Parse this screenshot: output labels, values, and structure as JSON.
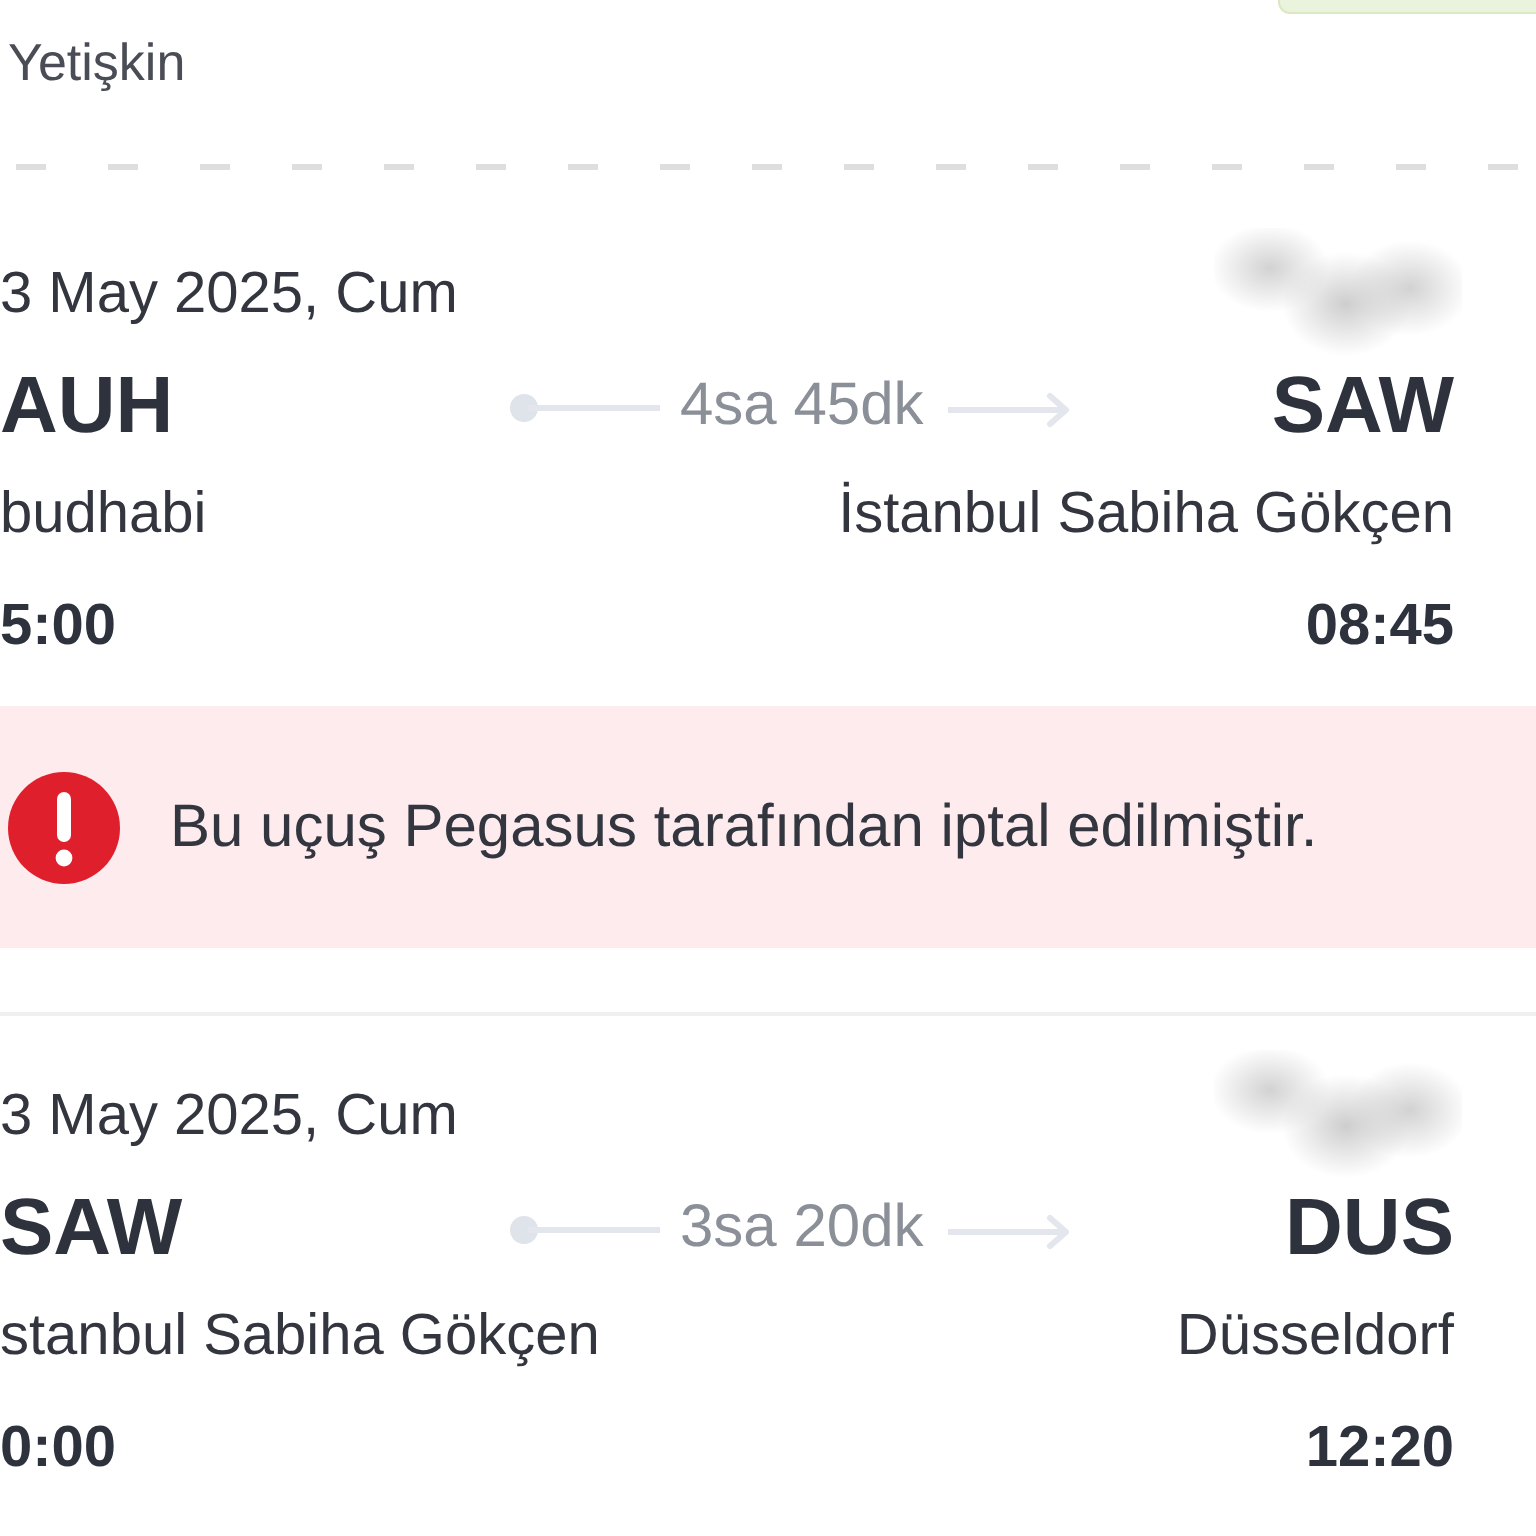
{
  "header": {
    "passenger_type": "Yetişkin"
  },
  "flights": [
    {
      "date": "3 May 2025, Cum",
      "origin": {
        "code": "AUH",
        "city": "budhabi",
        "time": "5:00"
      },
      "duration": "4sa 45dk",
      "destination": {
        "code": "SAW",
        "city": "İstanbul Sabiha Gökçen",
        "time": "08:45"
      },
      "alert": {
        "kind": "error",
        "message": "Bu uçuş Pegasus tarafından iptal edilmiştir."
      }
    },
    {
      "date": "3 May 2025, Cum",
      "origin": {
        "code": "SAW",
        "city": "stanbul Sabiha Gökçen",
        "time": "0:00"
      },
      "duration": "3sa 20dk",
      "destination": {
        "code": "DUS",
        "city": "Düsseldorf",
        "time": "12:20"
      }
    }
  ]
}
